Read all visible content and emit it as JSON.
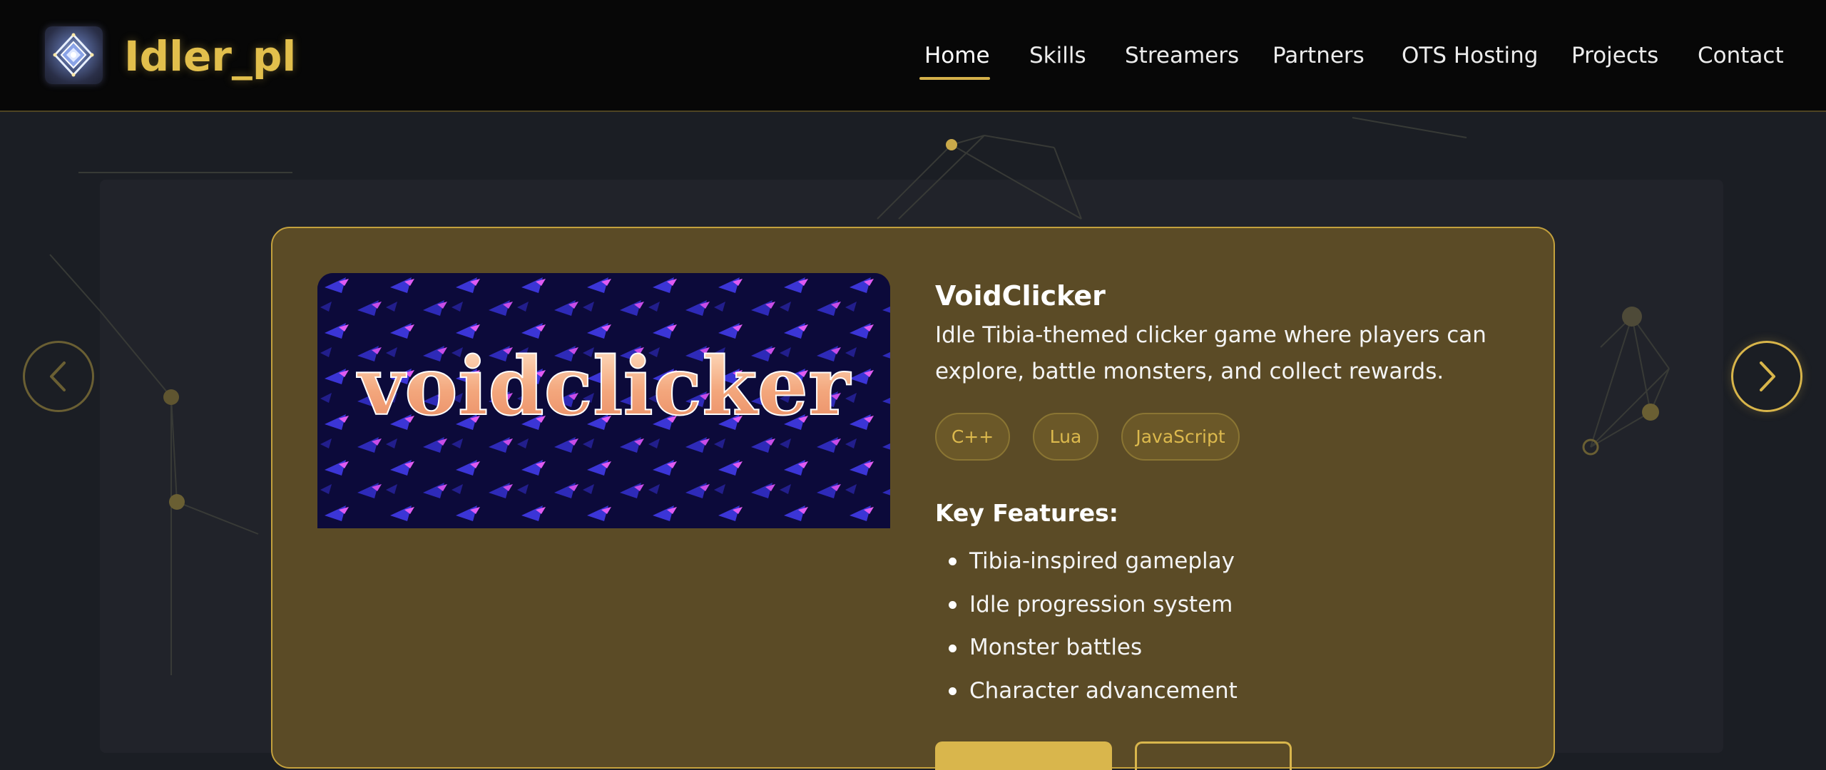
{
  "site": {
    "brand": "Idler_pl",
    "logo_icon": "diamond-logo-icon"
  },
  "nav": {
    "items": [
      {
        "label": "Home",
        "active": true
      },
      {
        "label": "Skills",
        "active": false
      },
      {
        "label": "Streamers",
        "active": false
      },
      {
        "label": "Partners",
        "active": false
      },
      {
        "label": "OTS Hosting",
        "active": false
      },
      {
        "label": "Projects",
        "active": false
      },
      {
        "label": "Contact",
        "active": false
      }
    ]
  },
  "carousel": {
    "prev_icon": "chevron-left-icon",
    "next_icon": "chevron-right-icon"
  },
  "project": {
    "title": "VoidClicker",
    "description": "Idle Tibia-themed clicker game where players can explore, battle monsters, and collect rewards.",
    "image_text": "voidclicker",
    "tags": [
      "C++",
      "Lua",
      "JavaScript"
    ],
    "features_heading": "Key Features:",
    "features": [
      "Tibia-inspired gameplay",
      "Idle progression system",
      "Monster battles",
      "Character advancement"
    ]
  },
  "colors": {
    "accent_gold": "#d9b64c",
    "card_bg": "#5b4b26",
    "page_bg": "#1b1e24",
    "header_bg": "#070707"
  }
}
